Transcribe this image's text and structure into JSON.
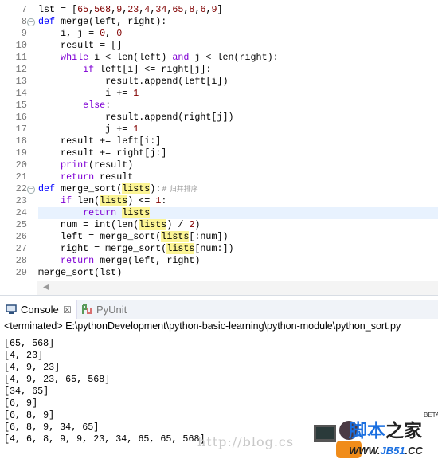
{
  "editor": {
    "line_numbers": [
      "7",
      "8",
      "9",
      "10",
      "11",
      "12",
      "13",
      "14",
      "15",
      "16",
      "17",
      "18",
      "19",
      "20",
      "21",
      "22",
      "23",
      "24",
      "25",
      "26",
      "27",
      "28",
      "29"
    ],
    "fold_lines": [
      "8",
      "22"
    ],
    "current_line": "24",
    "lines": [
      [
        [
          "n",
          "lst = ["
        ],
        [
          "num",
          "65"
        ],
        [
          "n",
          ","
        ],
        [
          "num",
          "568"
        ],
        [
          "n",
          ","
        ],
        [
          "num",
          "9"
        ],
        [
          "n",
          ","
        ],
        [
          "num",
          "23"
        ],
        [
          "n",
          ","
        ],
        [
          "num",
          "4"
        ],
        [
          "n",
          ","
        ],
        [
          "num",
          "34"
        ],
        [
          "n",
          ","
        ],
        [
          "num",
          "65"
        ],
        [
          "n",
          ","
        ],
        [
          "num",
          "8"
        ],
        [
          "n",
          ","
        ],
        [
          "num",
          "6"
        ],
        [
          "n",
          ","
        ],
        [
          "num",
          "9"
        ],
        [
          "n",
          "]"
        ]
      ],
      [
        [
          "kw",
          "def"
        ],
        [
          "n",
          " merge(left, right):"
        ]
      ],
      [
        [
          "n",
          "    i, j = "
        ],
        [
          "num",
          "0"
        ],
        [
          "n",
          ", "
        ],
        [
          "num",
          "0"
        ]
      ],
      [
        [
          "n",
          "    result = []"
        ]
      ],
      [
        [
          "kw2",
          "    while"
        ],
        [
          "n",
          " i < len(left) "
        ],
        [
          "kw2",
          "and"
        ],
        [
          "n",
          " j < len(right):"
        ]
      ],
      [
        [
          "kw2",
          "        if"
        ],
        [
          "n",
          " left[i] <= right[j]:"
        ]
      ],
      [
        [
          "n",
          "            result.append(left[i])"
        ]
      ],
      [
        [
          "n",
          "            i += "
        ],
        [
          "num",
          "1"
        ]
      ],
      [
        [
          "kw2",
          "        else"
        ],
        [
          "n",
          ":"
        ]
      ],
      [
        [
          "n",
          "            result.append(right[j])"
        ]
      ],
      [
        [
          "n",
          "            j += "
        ],
        [
          "num",
          "1"
        ]
      ],
      [
        [
          "n",
          "    result += left[i:]"
        ]
      ],
      [
        [
          "n",
          "    result += right[j:]"
        ]
      ],
      [
        [
          "bi",
          "    print"
        ],
        [
          "n",
          "(result)"
        ]
      ],
      [
        [
          "kw2",
          "    return"
        ],
        [
          "n",
          " result"
        ]
      ],
      [
        [
          "kw",
          "def"
        ],
        [
          "n",
          " merge_sort("
        ],
        [
          "hl",
          "lists"
        ],
        [
          "n",
          "):"
        ],
        [
          "cm",
          "# 归并排序"
        ]
      ],
      [
        [
          "kw2",
          "    if"
        ],
        [
          "n",
          " len("
        ],
        [
          "hl",
          "lists"
        ],
        [
          "n",
          ") <= "
        ],
        [
          "num",
          "1"
        ],
        [
          "n",
          ":"
        ]
      ],
      [
        [
          "kw2",
          "        return"
        ],
        [
          "n",
          " "
        ],
        [
          "hl",
          "lists"
        ]
      ],
      [
        [
          "n",
          "    num = int(len("
        ],
        [
          "hl",
          "lists"
        ],
        [
          "n",
          ") / "
        ],
        [
          "num",
          "2"
        ],
        [
          "n",
          ")"
        ]
      ],
      [
        [
          "n",
          "    left = merge_sort("
        ],
        [
          "hl",
          "lists"
        ],
        [
          "n",
          "[:num])"
        ]
      ],
      [
        [
          "n",
          "    right = merge_sort("
        ],
        [
          "hl",
          "lists"
        ],
        [
          "n",
          "[num:])"
        ]
      ],
      [
        [
          "kw2",
          "    return"
        ],
        [
          "n",
          " merge(left, right)"
        ]
      ],
      [
        [
          "n",
          "merge_sort(lst)"
        ]
      ]
    ]
  },
  "console": {
    "tabs": [
      {
        "label": "Console",
        "icon": "console-icon",
        "close": "☒"
      },
      {
        "label": "PyUnit",
        "icon": "pyunit-icon"
      }
    ],
    "status": "<terminated> E:\\pythonDevelopment\\python-basic-learning\\python-module\\python_sort.py",
    "output": [
      "[65, 568]",
      "[4, 23]",
      "[4, 9, 23]",
      "[4, 9, 23, 65, 568]",
      "[34, 65]",
      "[6, 9]",
      "[6, 8, 9]",
      "[6, 8, 9, 34, 65]",
      "[4, 6, 8, 9, 9, 23, 34, 65, 65, 568]"
    ]
  },
  "watermark": {
    "text": "http://blog.cs",
    "logo_text": "脚本之家",
    "logo_url_text": "WWW.JB51.CC",
    "logo_badge": "BETA"
  },
  "colors": {
    "keyword": "#0000ff",
    "keyword2": "#7f00d4",
    "number": "#800000",
    "highlight": "#fcf595",
    "current_line": "#e8f2fe"
  }
}
